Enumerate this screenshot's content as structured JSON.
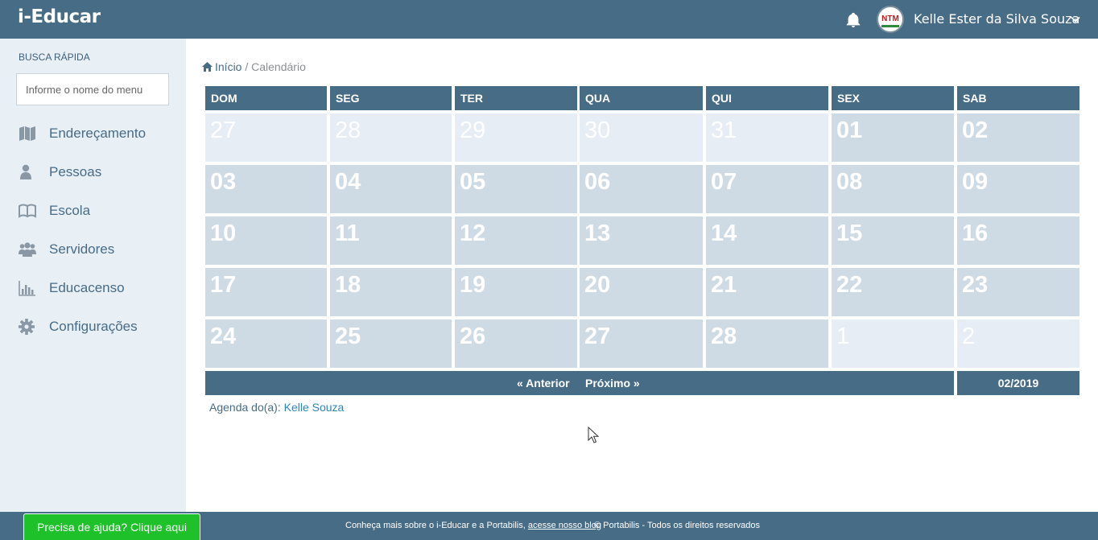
{
  "header": {
    "brand": "i-Educar",
    "user_name": "Kelle Ester da Silva Souza",
    "logo_text": "NTM"
  },
  "sidebar": {
    "search_label": "BUSCA RÁPIDA",
    "search_placeholder": "Informe o nome do menu",
    "items": [
      {
        "label": "Endereçamento",
        "icon": "map-icon"
      },
      {
        "label": "Pessoas",
        "icon": "user-icon"
      },
      {
        "label": "Escola",
        "icon": "book-icon"
      },
      {
        "label": "Servidores",
        "icon": "users-icon"
      },
      {
        "label": "Educacenso",
        "icon": "bar-chart-icon"
      },
      {
        "label": "Configurações",
        "icon": "gear-icon"
      }
    ]
  },
  "breadcrumb": {
    "home": "Início",
    "separator": "/",
    "current": "Calendário"
  },
  "calendar": {
    "weekdays": [
      "DOM",
      "SEG",
      "TER",
      "QUA",
      "QUI",
      "SEX",
      "SAB"
    ],
    "weeks": [
      [
        {
          "d": "27",
          "other": true
        },
        {
          "d": "28",
          "other": true
        },
        {
          "d": "29",
          "other": true
        },
        {
          "d": "30",
          "other": true
        },
        {
          "d": "31",
          "other": true
        },
        {
          "d": "01",
          "other": false
        },
        {
          "d": "02",
          "other": false
        }
      ],
      [
        {
          "d": "03",
          "other": false
        },
        {
          "d": "04",
          "other": false
        },
        {
          "d": "05",
          "other": false
        },
        {
          "d": "06",
          "other": false
        },
        {
          "d": "07",
          "other": false
        },
        {
          "d": "08",
          "other": false
        },
        {
          "d": "09",
          "other": false
        }
      ],
      [
        {
          "d": "10",
          "other": false
        },
        {
          "d": "11",
          "other": false
        },
        {
          "d": "12",
          "other": false
        },
        {
          "d": "13",
          "other": false
        },
        {
          "d": "14",
          "other": false
        },
        {
          "d": "15",
          "other": false
        },
        {
          "d": "16",
          "other": false
        }
      ],
      [
        {
          "d": "17",
          "other": false
        },
        {
          "d": "18",
          "other": false
        },
        {
          "d": "19",
          "other": false
        },
        {
          "d": "20",
          "other": false
        },
        {
          "d": "21",
          "other": false
        },
        {
          "d": "22",
          "other": false
        },
        {
          "d": "23",
          "other": false
        }
      ],
      [
        {
          "d": "24",
          "other": false
        },
        {
          "d": "25",
          "other": false
        },
        {
          "d": "26",
          "other": false
        },
        {
          "d": "27",
          "other": false
        },
        {
          "d": "28",
          "other": false
        },
        {
          "d": "1",
          "other": true
        },
        {
          "d": "2",
          "other": true
        }
      ]
    ],
    "prev_label": "« Anterior",
    "next_label": "Próximo »",
    "month": "02/2019"
  },
  "agenda": {
    "label": "Agenda do(a):",
    "user": "Kelle Souza"
  },
  "footer": {
    "text": "Conheça mais sobre o i-Educar e a Portabilis,",
    "link": "acesse nosso blog",
    "copyright": "© Portabilis - Todos os direitos reservados",
    "help": "Precisa de ajuda? Clique aqui"
  },
  "colors": {
    "primary": "#476c86",
    "cell": "#cfdbe4",
    "cell_other": "#e6edf4",
    "sidebar_bg": "#e8eff5",
    "help_green": "#1fc12b"
  }
}
